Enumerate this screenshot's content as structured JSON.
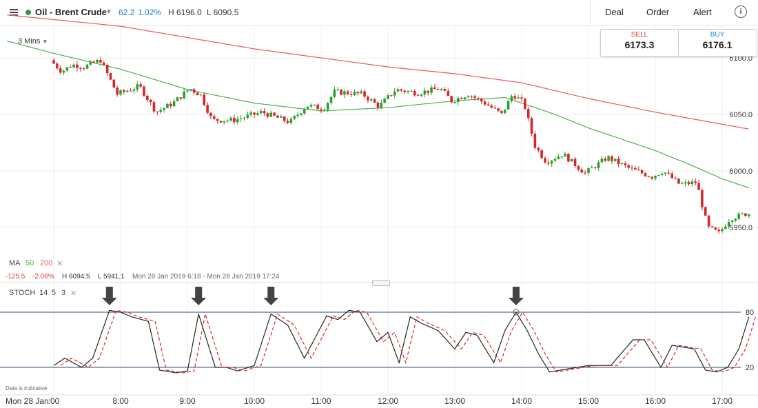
{
  "header": {
    "instrument": "Oil - Brent Crude",
    "change": "62.2",
    "change_pct": "1.02%",
    "high": "H 6196.0",
    "low": "L 6090.5",
    "deal_label": "Deal",
    "order_label": "Order",
    "alert_label": "Alert",
    "info_label": "i"
  },
  "quote": {
    "sell_label": "SELL",
    "sell_price": "6173.3",
    "buy_label": "BUY",
    "buy_price": "6176.1"
  },
  "timeframe": "3 Mins",
  "legend": {
    "ma_label": "MA",
    "ma_fast": "50",
    "ma_slow": "200",
    "change": "-125.5",
    "change_pct": "-2.06%",
    "high": "H 6094.5",
    "low": "L 5941.1",
    "range": "Mon 28 Jan 2019 6:18 - Mon 28 Jan 2019 17:24",
    "stoch_label": "STOCH",
    "stoch_k": "14",
    "stoch_d": "5",
    "stoch_s": "3",
    "data_note": "Data is indicative"
  },
  "colors": {
    "up": "#2ca02c",
    "down": "#d62728",
    "ma50": "#4caf50",
    "ma200": "#e35b5b",
    "stoch_k": "#222222",
    "stoch_d": "#d62728",
    "accent": "#1f7fbf",
    "arrow": "#444444"
  },
  "chart_data": [
    {
      "type": "candlestick",
      "ylim": [
        5920,
        6120
      ],
      "yticks": [
        6100,
        6050,
        6000,
        5950
      ],
      "ytick_labels": [
        "6100.0",
        "6050.0",
        "6000.0",
        "5950.0"
      ],
      "xticks": [
        ":00",
        "8:00",
        "9:00",
        "10:00",
        "11:00",
        "12:00",
        "13:00",
        "14:00",
        "15:00",
        "16:00",
        "17:00"
      ],
      "date_label": "Mon 28 Jan",
      "anchors": [
        {
          "t": "7:00",
          "v": 6098
        },
        {
          "t": "7:10",
          "v": 6088
        },
        {
          "t": "7:20",
          "v": 6094
        },
        {
          "t": "7:30",
          "v": 6092
        },
        {
          "t": "7:45",
          "v": 6098
        },
        {
          "t": "8:00",
          "v": 6068
        },
        {
          "t": "8:20",
          "v": 6075
        },
        {
          "t": "8:35",
          "v": 6052
        },
        {
          "t": "8:50",
          "v": 6060
        },
        {
          "t": "9:05",
          "v": 6073
        },
        {
          "t": "9:15",
          "v": 6067
        },
        {
          "t": "9:25",
          "v": 6045
        },
        {
          "t": "9:45",
          "v": 6045
        },
        {
          "t": "10:10",
          "v": 6052
        },
        {
          "t": "10:35",
          "v": 6043
        },
        {
          "t": "10:50",
          "v": 6058
        },
        {
          "t": "11:05",
          "v": 6055
        },
        {
          "t": "11:15",
          "v": 6070
        },
        {
          "t": "11:40",
          "v": 6068
        },
        {
          "t": "11:55",
          "v": 6057
        },
        {
          "t": "12:10",
          "v": 6072
        },
        {
          "t": "12:30",
          "v": 6069
        },
        {
          "t": "12:50",
          "v": 6073
        },
        {
          "t": "13:00",
          "v": 6062
        },
        {
          "t": "13:15",
          "v": 6068
        },
        {
          "t": "13:30",
          "v": 6060
        },
        {
          "t": "13:45",
          "v": 6050
        },
        {
          "t": "13:55",
          "v": 6068
        },
        {
          "t": "14:05",
          "v": 6060
        },
        {
          "t": "14:15",
          "v": 6022
        },
        {
          "t": "14:25",
          "v": 6008
        },
        {
          "t": "14:40",
          "v": 6015
        },
        {
          "t": "15:00",
          "v": 5998
        },
        {
          "t": "15:20",
          "v": 6012
        },
        {
          "t": "15:40",
          "v": 6002
        },
        {
          "t": "16:00",
          "v": 5995
        },
        {
          "t": "16:10",
          "v": 6000
        },
        {
          "t": "16:25",
          "v": 5988
        },
        {
          "t": "16:40",
          "v": 5990
        },
        {
          "t": "16:50",
          "v": 5950
        },
        {
          "t": "17:00",
          "v": 5945
        },
        {
          "t": "17:10",
          "v": 5958
        },
        {
          "t": "17:24",
          "v": 5962
        }
      ],
      "ma50": [
        {
          "t": "6:18",
          "v": 6115
        },
        {
          "t": "7:00",
          "v": 6104
        },
        {
          "t": "8:00",
          "v": 6090
        },
        {
          "t": "9:00",
          "v": 6072
        },
        {
          "t": "10:00",
          "v": 6060
        },
        {
          "t": "11:00",
          "v": 6053
        },
        {
          "t": "12:00",
          "v": 6056
        },
        {
          "t": "13:00",
          "v": 6062
        },
        {
          "t": "13:45",
          "v": 6065
        },
        {
          "t": "14:30",
          "v": 6050
        },
        {
          "t": "15:00",
          "v": 6038
        },
        {
          "t": "15:30",
          "v": 6028
        },
        {
          "t": "16:00",
          "v": 6018
        },
        {
          "t": "16:30",
          "v": 6006
        },
        {
          "t": "17:00",
          "v": 5993
        },
        {
          "t": "17:24",
          "v": 5985
        }
      ],
      "ma200": [
        {
          "t": "6:18",
          "v": 6138
        },
        {
          "t": "8:00",
          "v": 6128
        },
        {
          "t": "10:00",
          "v": 6108
        },
        {
          "t": "12:00",
          "v": 6092
        },
        {
          "t": "13:00",
          "v": 6086
        },
        {
          "t": "14:00",
          "v": 6078
        },
        {
          "t": "15:00",
          "v": 6064
        },
        {
          "t": "16:00",
          "v": 6052
        },
        {
          "t": "17:24",
          "v": 6037
        }
      ]
    },
    {
      "type": "line",
      "name": "STOCH",
      "ylim": [
        10,
        95
      ],
      "levels": [
        80,
        20
      ],
      "level_labels": [
        "80",
        "20"
      ],
      "k_anchors": [
        {
          "t": "7:00",
          "v": 22
        },
        {
          "t": "7:10",
          "v": 30
        },
        {
          "t": "7:25",
          "v": 20
        },
        {
          "t": "7:35",
          "v": 30
        },
        {
          "t": "7:50",
          "v": 82
        },
        {
          "t": "8:00",
          "v": 80
        },
        {
          "t": "8:10",
          "v": 75
        },
        {
          "t": "8:25",
          "v": 70
        },
        {
          "t": "8:35",
          "v": 17
        },
        {
          "t": "8:50",
          "v": 14
        },
        {
          "t": "9:00",
          "v": 16
        },
        {
          "t": "9:10",
          "v": 78
        },
        {
          "t": "9:25",
          "v": 20
        },
        {
          "t": "9:35",
          "v": 20
        },
        {
          "t": "9:45",
          "v": 16
        },
        {
          "t": "10:00",
          "v": 22
        },
        {
          "t": "10:15",
          "v": 78
        },
        {
          "t": "10:30",
          "v": 66
        },
        {
          "t": "10:45",
          "v": 30
        },
        {
          "t": "11:05",
          "v": 76
        },
        {
          "t": "11:15",
          "v": 72
        },
        {
          "t": "11:25",
          "v": 82
        },
        {
          "t": "11:35",
          "v": 80
        },
        {
          "t": "11:50",
          "v": 48
        },
        {
          "t": "12:00",
          "v": 58
        },
        {
          "t": "12:10",
          "v": 25
        },
        {
          "t": "12:20",
          "v": 75
        },
        {
          "t": "12:30",
          "v": 68
        },
        {
          "t": "12:45",
          "v": 60
        },
        {
          "t": "13:00",
          "v": 40
        },
        {
          "t": "13:10",
          "v": 58
        },
        {
          "t": "13:20",
          "v": 55
        },
        {
          "t": "13:35",
          "v": 25
        },
        {
          "t": "13:45",
          "v": 60
        },
        {
          "t": "13:55",
          "v": 80
        },
        {
          "t": "14:05",
          "v": 60
        },
        {
          "t": "14:15",
          "v": 35
        },
        {
          "t": "14:25",
          "v": 15
        },
        {
          "t": "14:40",
          "v": 18
        },
        {
          "t": "15:00",
          "v": 22
        },
        {
          "t": "15:20",
          "v": 22
        },
        {
          "t": "15:40",
          "v": 50
        },
        {
          "t": "15:50",
          "v": 50
        },
        {
          "t": "16:05",
          "v": 20
        },
        {
          "t": "16:15",
          "v": 44
        },
        {
          "t": "16:35",
          "v": 40
        },
        {
          "t": "16:45",
          "v": 17
        },
        {
          "t": "16:55",
          "v": 15
        },
        {
          "t": "17:05",
          "v": 20
        },
        {
          "t": "17:15",
          "v": 40
        },
        {
          "t": "17:24",
          "v": 75
        }
      ],
      "d_lag_minutes": 6,
      "arrows": [
        "7:50",
        "9:10",
        "10:15",
        "13:55"
      ]
    }
  ]
}
